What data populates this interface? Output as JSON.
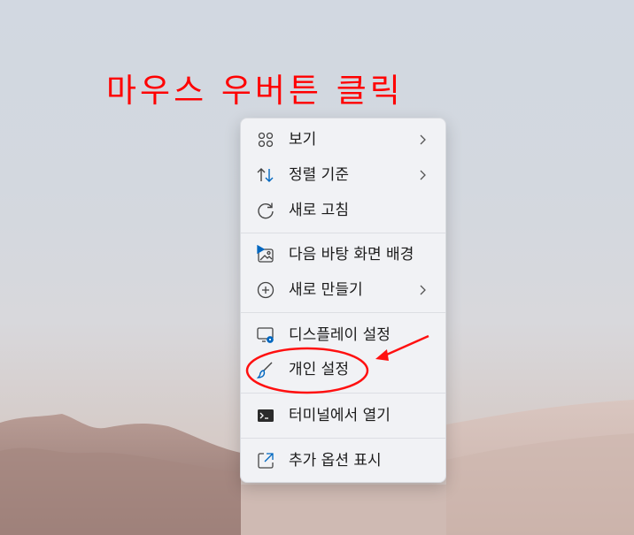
{
  "annotation": {
    "title": "마우스 우버튼 클릭",
    "color": "#ff0000"
  },
  "menu": {
    "items": [
      {
        "label": "보기",
        "icon": "grid-view-icon",
        "submenu": true
      },
      {
        "label": "정렬 기준",
        "icon": "sort-arrows-icon",
        "submenu": true
      },
      {
        "label": "새로 고침",
        "icon": "refresh-icon",
        "submenu": false
      },
      {
        "label": "다음 바탕 화면 배경",
        "icon": "next-background-icon",
        "submenu": false
      },
      {
        "label": "새로 만들기",
        "icon": "plus-circle-icon",
        "submenu": true
      },
      {
        "label": "디스플레이 설정",
        "icon": "display-settings-icon",
        "submenu": false
      },
      {
        "label": "개인 설정",
        "icon": "brush-icon",
        "submenu": false
      },
      {
        "label": "터미널에서 열기",
        "icon": "terminal-icon",
        "submenu": false
      },
      {
        "label": "추가 옵션 표시",
        "icon": "show-more-icon",
        "submenu": false
      }
    ],
    "accent_color": "#0067c0"
  }
}
